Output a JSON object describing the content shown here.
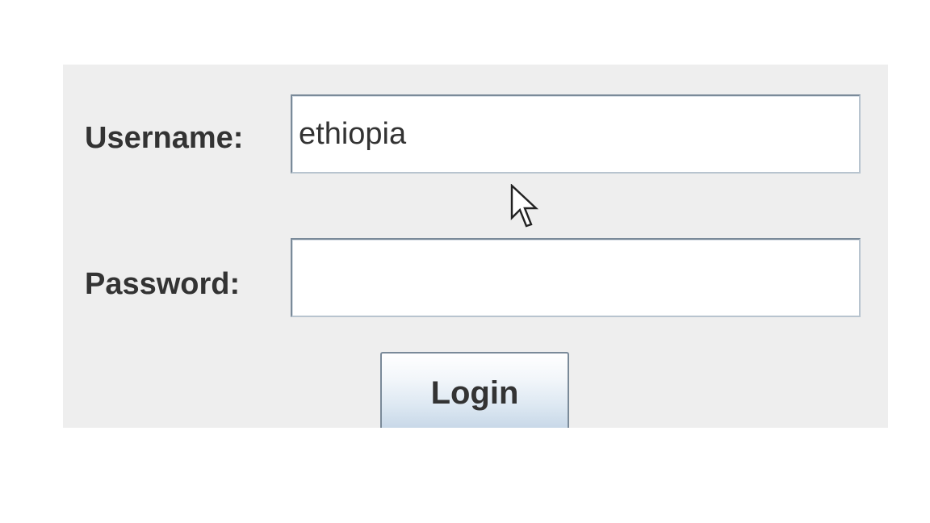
{
  "login_form": {
    "username_label": "Username:",
    "username_value": "ethiopia",
    "password_label": "Password:",
    "password_value": "",
    "login_button_label": "Login"
  },
  "cursor": {
    "icon": "arrow-pointer-icon"
  },
  "colors": {
    "panel_background": "#eeeeee",
    "page_background": "#ffffff",
    "label_text": "#333333",
    "field_border": "#7a8a99",
    "button_gradient_bottom": "#c8d8e8"
  }
}
